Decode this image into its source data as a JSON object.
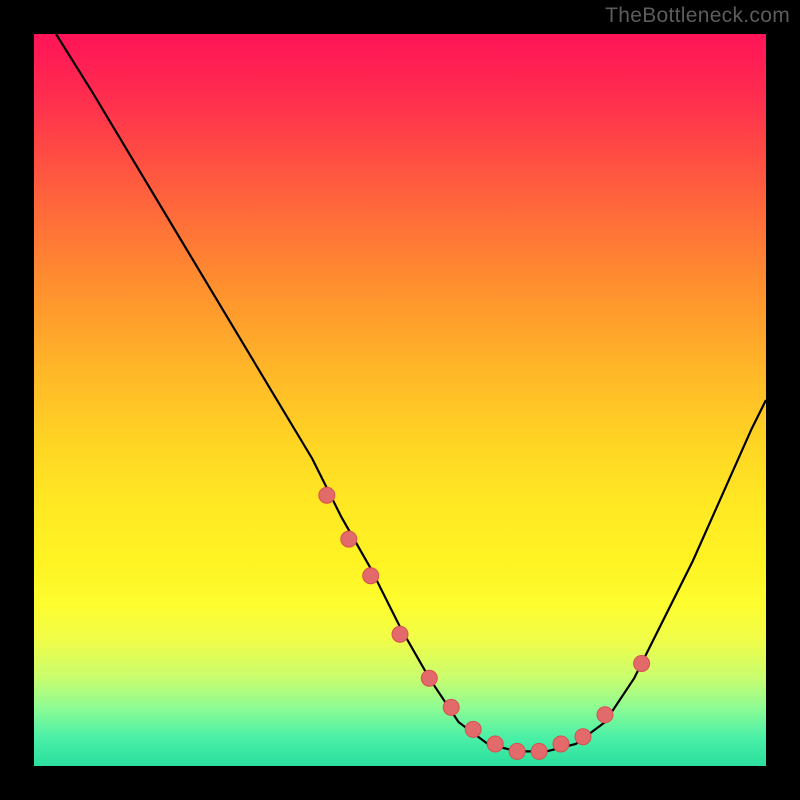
{
  "attribution": "TheBottleneck.com",
  "colors": {
    "frame": "#000000",
    "attribution_text": "#5c5c5c",
    "curve_stroke": "#000000",
    "marker_fill": "#e36a6a",
    "marker_stroke": "#d94f4f"
  },
  "chart_data": {
    "type": "line",
    "title": "",
    "xlabel": "",
    "ylabel": "",
    "xlim": [
      0,
      100
    ],
    "ylim": [
      0,
      100
    ],
    "grid": false,
    "legend": false,
    "series": [
      {
        "name": "bottleneck-curve",
        "x": [
          3,
          8,
          14,
          20,
          26,
          32,
          38,
          42,
          46,
          50,
          54,
          58,
          62,
          66,
          70,
          74,
          78,
          82,
          86,
          90,
          94,
          98,
          100
        ],
        "y": [
          100,
          92,
          82,
          72,
          62,
          52,
          42,
          34,
          27,
          19,
          12,
          6,
          3,
          2,
          2,
          3,
          6,
          12,
          20,
          28,
          37,
          46,
          50
        ]
      }
    ],
    "markers": {
      "name": "highlight-points",
      "x": [
        40,
        43,
        46,
        50,
        54,
        57,
        60,
        63,
        66,
        69,
        72,
        75,
        78,
        83
      ],
      "y": [
        37,
        31,
        26,
        18,
        12,
        8,
        5,
        3,
        2,
        2,
        3,
        4,
        7,
        14
      ]
    }
  }
}
